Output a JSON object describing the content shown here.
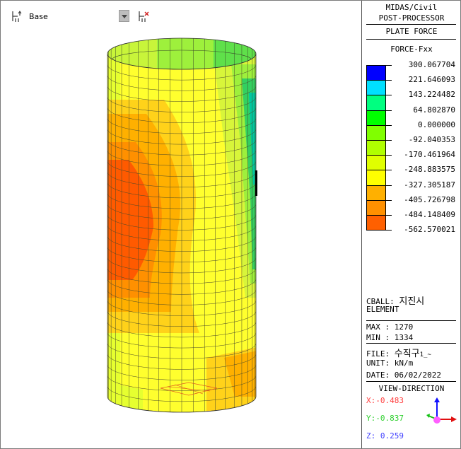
{
  "toolbar": {
    "stage_value": "Base"
  },
  "legend": {
    "program": "MIDAS/Civil",
    "mode": "POST-PROCESSOR",
    "result_type": "PLATE FORCE",
    "component": "FORCE-Fxx",
    "entries": [
      {
        "value": "300.067704",
        "color": "#0000ff"
      },
      {
        "value": "221.646093",
        "color": "#00e0ff"
      },
      {
        "value": "143.224482",
        "color": "#00ff80"
      },
      {
        "value": "64.802870",
        "color": "#00ff00"
      },
      {
        "value": "0.000000",
        "color": "#80ff00"
      },
      {
        "value": "-92.040353",
        "color": "#b0ff00"
      },
      {
        "value": "-170.461964",
        "color": "#e0ff00"
      },
      {
        "value": "-248.883575",
        "color": "#ffff00"
      },
      {
        "value": "-327.305187",
        "color": "#ffb000"
      },
      {
        "value": "-405.726798",
        "color": "#ff9000"
      },
      {
        "value": "-484.148409",
        "color": "#ff6000"
      },
      {
        "value": "-562.570021",
        "color": "#ff3000"
      }
    ]
  },
  "info": {
    "cball_label": "CBALL:",
    "cball_value": "지진시",
    "element": "ELEMENT",
    "max_label": "MAX :",
    "max_value": "1270",
    "min_label": "MIN :",
    "min_value": "1334",
    "file_label": "FILE:",
    "file_value": "수직구",
    "file_suffix": "1_~",
    "unit_label": "UNIT:",
    "unit_value": "kN/m",
    "date_label": "DATE:",
    "date_value": "06/02/2022"
  },
  "view_direction": {
    "title": "VIEW-DIRECTION",
    "x": "X:-0.483",
    "y": "Y:-0.837",
    "z": "Z: 0.259",
    "x_color": "#ff4040",
    "y_color": "#30d030",
    "z_color": "#4040ff"
  }
}
